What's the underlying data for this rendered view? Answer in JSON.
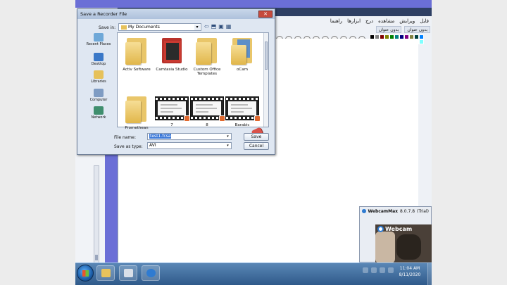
{
  "background_app": {
    "menu": [
      "فايل",
      "ويرايش",
      "مشاهده",
      "درج",
      "ابزارها",
      "راهنما"
    ],
    "tabs": [
      "بدون عنوان",
      "بدون عنوان"
    ],
    "palette": [
      "#000000",
      "#808080",
      "#800000",
      "#808000",
      "#008000",
      "#008080",
      "#000080",
      "#800080",
      "#808040",
      "#004040",
      "#0080ff",
      "#ffffff",
      "#c0c0c0",
      "#ff0000",
      "#ffff00",
      "#00ff00",
      "#00ffff",
      "#0000ff",
      "#ff00ff",
      "#ffff80",
      "#00ff80",
      "#80ffff"
    ]
  },
  "dialog": {
    "title": "Save a Recorder File",
    "close_glyph": "✕",
    "save_in_label": "Save in:",
    "save_in_value": "My Documents",
    "places": [
      {
        "label": "Recent Places",
        "icon": "recent-places-icon",
        "color": "#6fa8d8"
      },
      {
        "label": "Desktop",
        "icon": "desktop-icon",
        "color": "#3a78c8"
      },
      {
        "label": "Libraries",
        "icon": "libraries-icon",
        "color": "#e6c15a"
      },
      {
        "label": "Computer",
        "icon": "computer-icon",
        "color": "#7f9cc3"
      },
      {
        "label": "Network",
        "icon": "network-icon",
        "color": "#3f8e6e"
      }
    ],
    "files": [
      {
        "label": "Activ Software",
        "kind": "folder"
      },
      {
        "label": "Camtasia Studio",
        "kind": "folder-camtasia"
      },
      {
        "label": "Custom Office Templates",
        "kind": "folder"
      },
      {
        "label": "oCam",
        "kind": "folder-ocam"
      },
      {
        "label": "Promethean",
        "kind": "folder"
      },
      {
        "label": "7",
        "kind": "video"
      },
      {
        "label": "8",
        "kind": "video"
      },
      {
        "label": "Barabic",
        "kind": "video"
      }
    ],
    "file_name_label": "File name:",
    "file_name_value": "test1.fcsa",
    "save_as_type_label": "Save as type:",
    "save_as_type_value": "AVI",
    "save_button": "Save",
    "cancel_button": "Cancel"
  },
  "webcam": {
    "title": "WebcamMax",
    "version": "8.0.7.8",
    "trial": "(Trial)",
    "brand": "Webcam"
  },
  "taskbar": {
    "time": "11:04 AM",
    "date": "8/11/2020"
  }
}
